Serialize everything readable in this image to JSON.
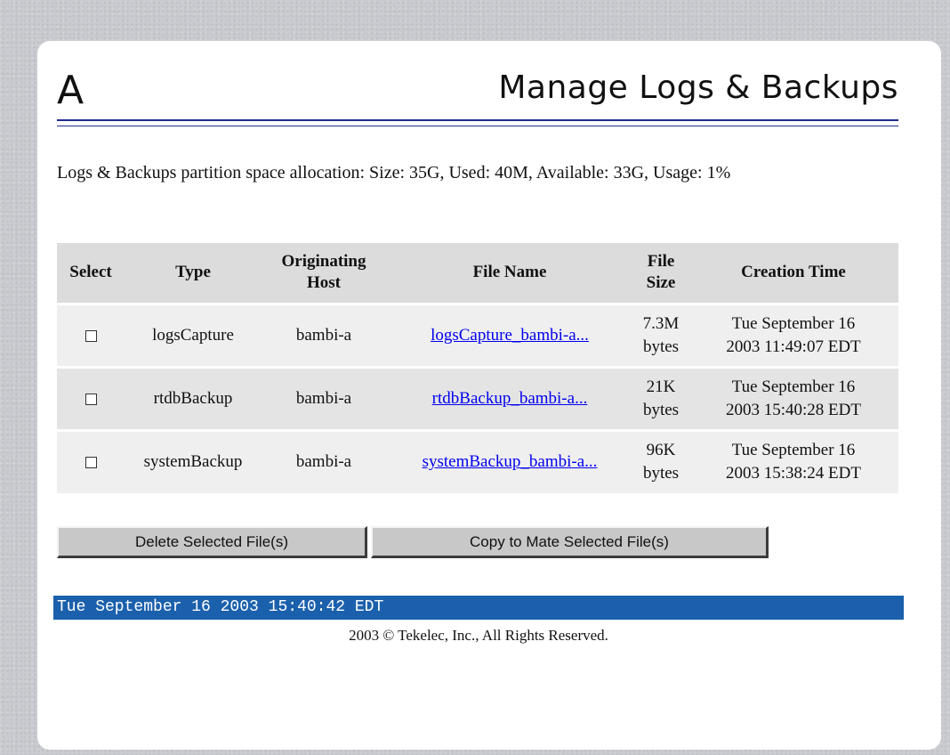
{
  "header": {
    "logo_letter": "A",
    "title": "Manage Logs & Backups"
  },
  "partition_info": "Logs & Backups partition space allocation: Size: 35G, Used: 40M, Available: 33G, Usage: 1%",
  "table": {
    "columns": [
      "Select",
      "Type",
      "Originating Host",
      "File Name",
      "File Size",
      "Creation Time"
    ],
    "rows": [
      {
        "checked": false,
        "type": "logsCapture",
        "host": "bambi-a",
        "file_name": "logsCapture_bambi-a...",
        "size_value": "7.3M",
        "size_unit": "bytes",
        "time_line1": "Tue September 16",
        "time_line2": "2003 11:49:07 EDT"
      },
      {
        "checked": false,
        "type": "rtdbBackup",
        "host": "bambi-a",
        "file_name": "rtdbBackup_bambi-a...",
        "size_value": "21K",
        "size_unit": "bytes",
        "time_line1": "Tue September 16",
        "time_line2": "2003 15:40:28 EDT"
      },
      {
        "checked": false,
        "type": "systemBackup",
        "host": "bambi-a",
        "file_name": "systemBackup_bambi-a...",
        "size_value": "96K",
        "size_unit": "bytes",
        "time_line1": "Tue September 16",
        "time_line2": "2003 15:38:24 EDT"
      }
    ]
  },
  "buttons": {
    "delete": "Delete Selected File(s)",
    "copy": "Copy to Mate Selected File(s)"
  },
  "status_bar": "Tue September 16 2003 15:40:42 EDT",
  "copyright": "2003 © Tekelec, Inc., All Rights Reserved.",
  "colors": {
    "rule": "#1e2c8c",
    "status_bar": "#1b60ac",
    "link": "#0000ee"
  }
}
